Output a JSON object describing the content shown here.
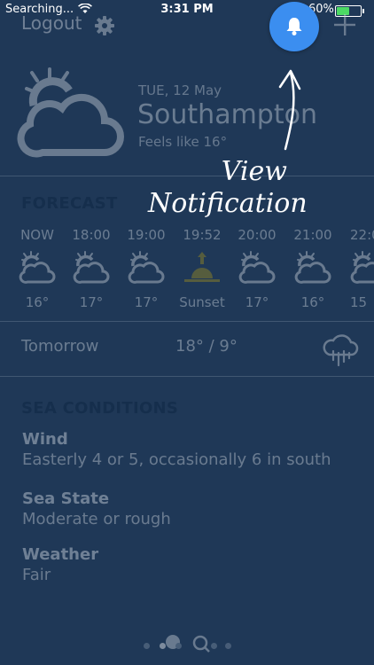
{
  "status_bar": {
    "carrier": "Searching...",
    "time": "3:31 PM",
    "battery_percent": "60%",
    "battery_level": 0.6
  },
  "header": {
    "logout": "Logout",
    "settings_icon": "gear-icon",
    "notification_icon": "bell-icon",
    "add_icon": "plus-icon"
  },
  "current": {
    "date": "TUE, 12 May",
    "city": "Southampton",
    "feels_like": "Feels like 16°",
    "icon": "partly-cloudy-icon"
  },
  "forecast": {
    "title": "FORECAST",
    "hours": [
      {
        "time": "NOW",
        "icon": "partly-cloudy-icon",
        "temp": "16°"
      },
      {
        "time": "18:00",
        "icon": "partly-cloudy-icon",
        "temp": "17°"
      },
      {
        "time": "19:00",
        "icon": "partly-cloudy-icon",
        "temp": "17°"
      },
      {
        "time": "19:52",
        "icon": "sunset-icon",
        "temp": "Sunset"
      },
      {
        "time": "20:00",
        "icon": "partly-cloudy-icon",
        "temp": "17°"
      },
      {
        "time": "21:00",
        "icon": "partly-cloudy-icon",
        "temp": "16°"
      },
      {
        "time": "22:0",
        "icon": "partly-cloudy-icon",
        "temp": "15"
      }
    ]
  },
  "tomorrow": {
    "label": "Tomorrow",
    "temps": "18° / 9°",
    "icon": "rain-cloud-icon"
  },
  "sea": {
    "title": "SEA CONDITIONS",
    "items": [
      {
        "label": "Wind",
        "value": "Easterly 4 or 5, occasionally 6 in south"
      },
      {
        "label": "Sea State",
        "value": "Moderate or rough"
      },
      {
        "label": "Weather",
        "value": "Fair"
      }
    ]
  },
  "annotation": {
    "line1": "View",
    "line2": "Notification"
  },
  "page_indicator": {
    "count": 6,
    "active_index": 1
  },
  "colors": {
    "background": "#1f3857",
    "accent": "#3b8ef0",
    "section_title": "#09223f",
    "sunset": "#a3911c"
  }
}
